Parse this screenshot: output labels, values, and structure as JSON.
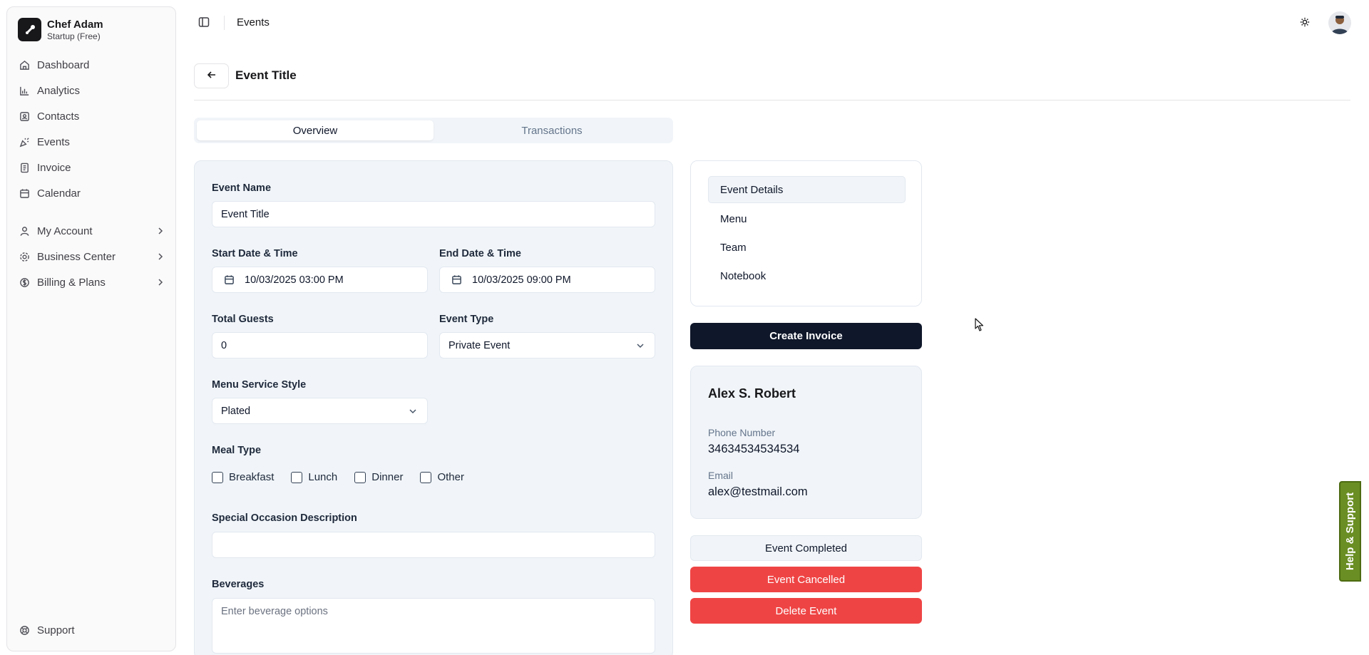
{
  "sidebar": {
    "brand": {
      "name": "Chef Adam",
      "plan": "Startup (Free)"
    },
    "main_items": [
      {
        "label": "Dashboard",
        "icon": "home-icon"
      },
      {
        "label": "Analytics",
        "icon": "bar-chart-icon"
      },
      {
        "label": "Contacts",
        "icon": "contacts-icon"
      },
      {
        "label": "Events",
        "icon": "party-popper-icon"
      },
      {
        "label": "Invoice",
        "icon": "invoice-icon"
      },
      {
        "label": "Calendar",
        "icon": "calendar-icon"
      }
    ],
    "group_items": [
      {
        "label": "My Account",
        "icon": "user-icon"
      },
      {
        "label": "Business Center",
        "icon": "settings-icon"
      },
      {
        "label": "Billing & Plans",
        "icon": "billing-icon"
      }
    ],
    "support_label": "Support"
  },
  "topbar": {
    "title": "Events"
  },
  "header": {
    "page_title": "Event Title"
  },
  "tabs": [
    {
      "label": "Overview",
      "active": true
    },
    {
      "label": "Transactions",
      "active": false
    }
  ],
  "form": {
    "event_name": {
      "label": "Event Name",
      "value": "Event Title"
    },
    "start": {
      "label": "Start Date & Time",
      "value": "10/03/2025 03:00 PM"
    },
    "end": {
      "label": "End Date & Time",
      "value": "10/03/2025 09:00 PM"
    },
    "guests": {
      "label": "Total Guests",
      "value": "0"
    },
    "event_type": {
      "label": "Event Type",
      "value": "Private Event"
    },
    "service_style": {
      "label": "Menu Service Style",
      "value": "Plated"
    },
    "meal_type": {
      "label": "Meal Type",
      "options": [
        "Breakfast",
        "Lunch",
        "Dinner",
        "Other"
      ]
    },
    "occasion": {
      "label": "Special Occasion Description",
      "value": ""
    },
    "beverages": {
      "label": "Beverages",
      "placeholder": "Enter beverage options"
    }
  },
  "details_nav": [
    "Event Details",
    "Menu",
    "Team",
    "Notebook"
  ],
  "actions": {
    "create_invoice": "Create Invoice",
    "completed": "Event Completed",
    "cancelled": "Event Cancelled",
    "delete": "Delete Event"
  },
  "contact": {
    "name": "Alex S. Robert",
    "phone_label": "Phone Number",
    "phone": "34634534534534",
    "email_label": "Email",
    "email": "alex@testmail.com"
  },
  "help_tab": "Help & Support",
  "colors": {
    "primary": "#0f172a",
    "danger": "#ef4444",
    "help": "#6a8e23"
  }
}
